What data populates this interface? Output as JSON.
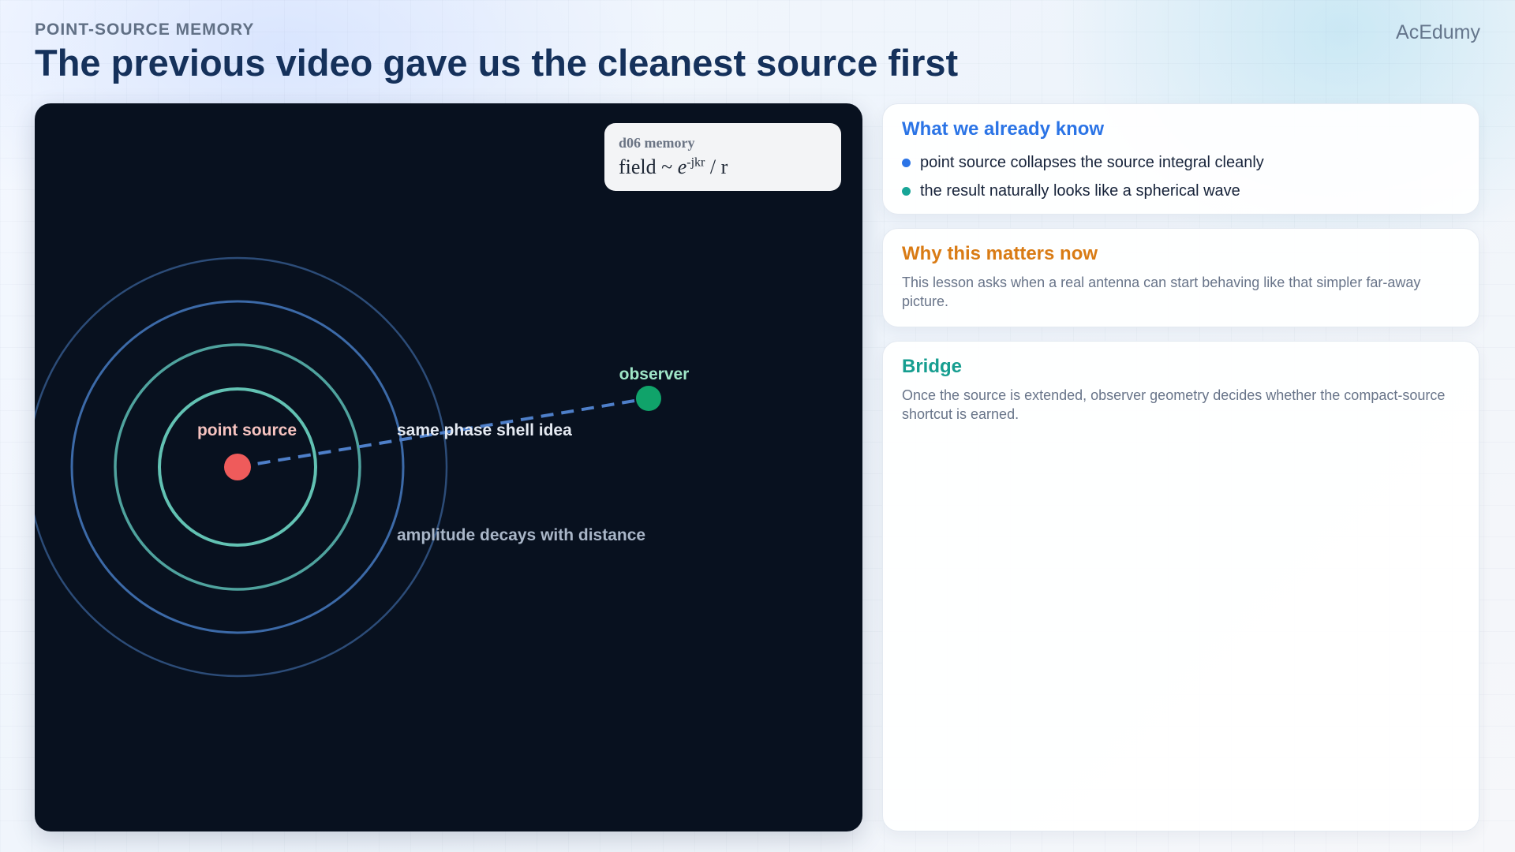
{
  "header": {
    "eyebrow": "POINT-SOURCE MEMORY",
    "title": "The previous video gave us the cleanest source first",
    "brand": "AcEdumy"
  },
  "diagram": {
    "memory_card": {
      "title": "d06 memory",
      "formula_prefix": "field ~ ",
      "formula_base": "e",
      "formula_exponent": "-jkr",
      "formula_suffix": " / r"
    },
    "labels": {
      "point_source": "point source",
      "observer": "observer",
      "shell_idea": "same phase shell idea",
      "amplitude": "amplitude decays with distance"
    },
    "colors": {
      "background": "#08111f",
      "source": "#ef5b5b",
      "observer": "#10a36a",
      "inner_shells": "#5fbfb0",
      "outer_shells": "#3c6aa8",
      "ray": "#4e7fc9"
    }
  },
  "cards": {
    "know": {
      "heading": "What we already know",
      "items": [
        "point source collapses the source integral cleanly",
        "the result naturally looks like a spherical wave"
      ]
    },
    "why": {
      "heading": "Why this matters now",
      "body": "This lesson asks when a real antenna can start behaving like that simpler far-away picture."
    },
    "bridge": {
      "heading": "Bridge",
      "body": "Once the source is extended, observer geometry decides whether the compact-source shortcut is earned."
    }
  }
}
